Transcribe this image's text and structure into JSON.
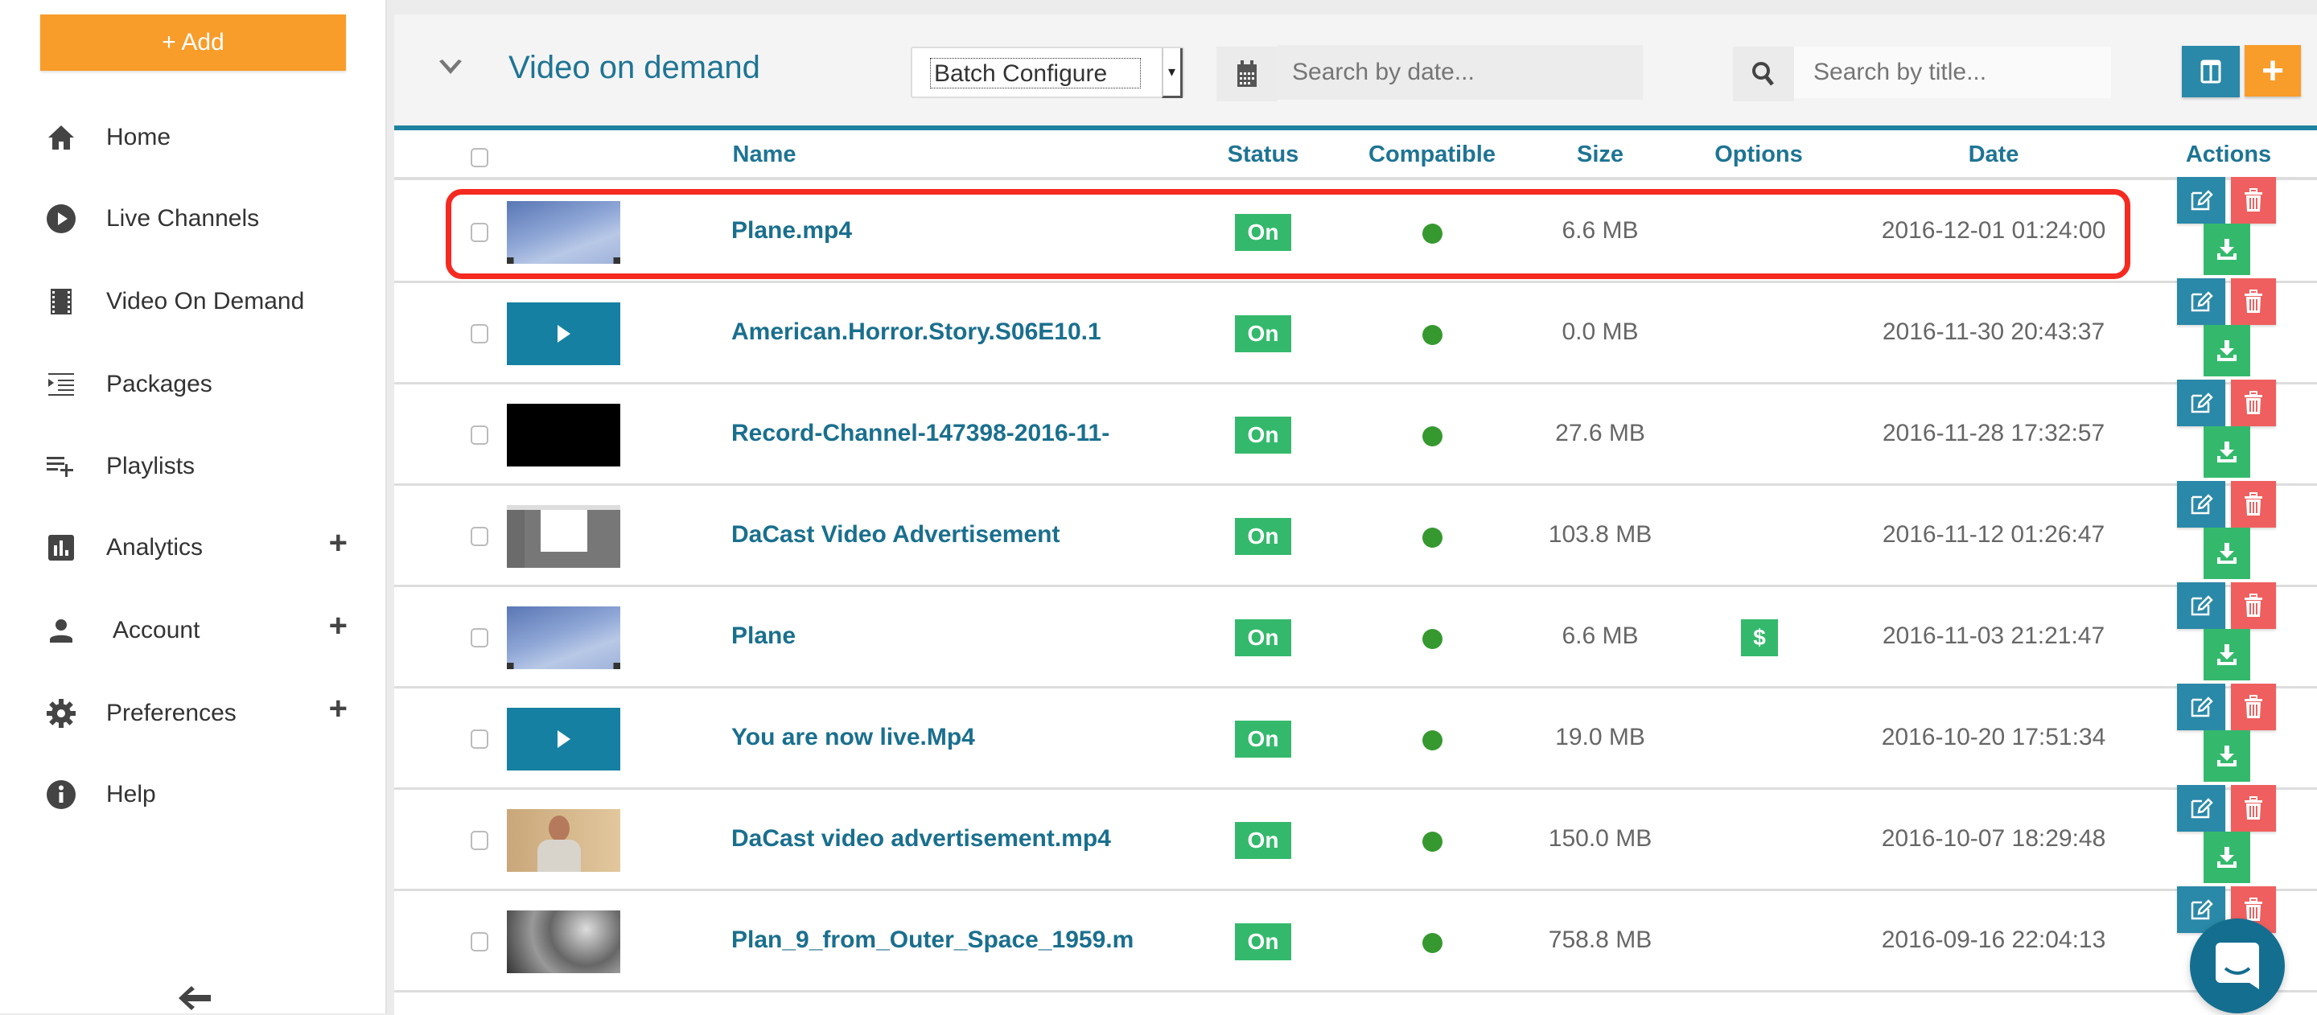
{
  "sidebar": {
    "add_label": "+ Add",
    "items": [
      {
        "label": "Home",
        "icon": "home-icon",
        "expandable": false
      },
      {
        "label": "Live Channels",
        "icon": "play-circle-icon",
        "expandable": false
      },
      {
        "label": "Video On Demand",
        "icon": "film-icon",
        "expandable": false
      },
      {
        "label": "Packages",
        "icon": "indent-list-icon",
        "expandable": false
      },
      {
        "label": "Playlists",
        "icon": "playlist-add-icon",
        "expandable": false
      },
      {
        "label": "Analytics",
        "icon": "bar-chart-icon",
        "expandable": true
      },
      {
        "label": "Account",
        "icon": "person-icon",
        "expandable": true
      },
      {
        "label": "Preferences",
        "icon": "gear-icon",
        "expandable": true
      },
      {
        "label": "Help",
        "icon": "info-icon",
        "expandable": false
      }
    ],
    "expand_symbol": "+",
    "collapse_icon": "arrow-left-icon"
  },
  "header": {
    "title": "Video on demand",
    "batch_select": {
      "selected": "Batch Configure"
    },
    "date_search": {
      "placeholder": "Search by date..."
    },
    "title_search": {
      "placeholder": "Search by title..."
    },
    "add_symbol": "+"
  },
  "table": {
    "columns": [
      "Name",
      "Status",
      "Compatible",
      "Size",
      "Options",
      "Date",
      "Actions"
    ],
    "rows": [
      {
        "name": "Plane.mp4",
        "thumb": "sky",
        "status": "On",
        "compatible": true,
        "size": "6.6 MB",
        "option": "",
        "date": "2016-12-01 01:24:00",
        "highlighted": true
      },
      {
        "name": "American.Horror.Story.S06E10.1",
        "thumb": "play",
        "status": "On",
        "compatible": true,
        "size": "0.0 MB",
        "option": "",
        "date": "2016-11-30 20:43:37"
      },
      {
        "name": "Record-Channel-147398-2016-11-",
        "thumb": "black",
        "status": "On",
        "compatible": true,
        "size": "27.6 MB",
        "option": "",
        "date": "2016-11-28 17:32:57"
      },
      {
        "name": "DaCast Video Advertisement",
        "thumb": "screenshot",
        "status": "On",
        "compatible": true,
        "size": "103.8 MB",
        "option": "",
        "date": "2016-11-12 01:26:47"
      },
      {
        "name": "Plane",
        "thumb": "sky",
        "status": "On",
        "compatible": true,
        "size": "6.6 MB",
        "option": "$",
        "date": "2016-11-03 21:21:47"
      },
      {
        "name": "You are now live.Mp4",
        "thumb": "play",
        "status": "On",
        "compatible": true,
        "size": "19.0 MB",
        "option": "",
        "date": "2016-10-20 17:51:34"
      },
      {
        "name": "DaCast video advertisement.mp4",
        "thumb": "person",
        "status": "On",
        "compatible": true,
        "size": "150.0 MB",
        "option": "",
        "date": "2016-10-07 18:29:48"
      },
      {
        "name": "Plan_9_from_Outer_Space_1959.m",
        "thumb": "clouds",
        "status": "On",
        "compatible": true,
        "size": "758.8 MB",
        "option": "",
        "date": "2016-09-16 22:04:13"
      }
    ]
  },
  "colors": {
    "accent_teal": "#1e82a0",
    "orange": "#f89c2a",
    "green": "#34b96c",
    "red": "#ef5f5f",
    "highlight": "#f52a20"
  }
}
